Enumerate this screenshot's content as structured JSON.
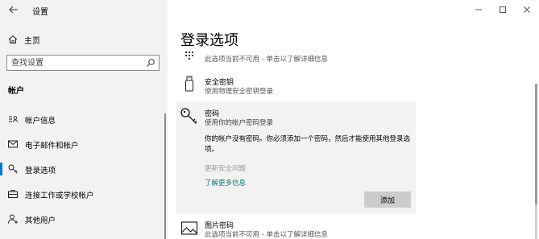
{
  "app": {
    "title": "设置"
  },
  "sidebar": {
    "home_label": "主页",
    "search_placeholder": "查找设置",
    "section_title": "帐户",
    "items": [
      {
        "label": "帐户信息",
        "icon": "person-card-icon"
      },
      {
        "label": "电子邮件和帐户",
        "icon": "mail-icon"
      },
      {
        "label": "登录选项",
        "icon": "key-icon",
        "active": true
      },
      {
        "label": "连接工作或学校帐户",
        "icon": "briefcase-icon"
      },
      {
        "label": "其他用户",
        "icon": "person-add-icon"
      }
    ]
  },
  "main": {
    "title": "登录选项",
    "pin_option": {
      "desc": "此选项当前不可用 - 单击以了解详细信息"
    },
    "security_key": {
      "name": "安全密钥",
      "desc": "使用物理安全密钥登录"
    },
    "password": {
      "name": "密码",
      "desc": "使用你的帐户密码登录",
      "message": "你的帐户没有密码。你必须添加一个密码，然后才能使用其他登录选项。",
      "disabled_link": "更新安全问题",
      "learn_more": "了解更多信息",
      "add_button": "添加"
    },
    "picture_password": {
      "name": "图片密码",
      "desc": "此选项当前不可用 - 单击以了解详细信息"
    }
  },
  "colors": {
    "accent": "#0078d7",
    "link": "#0a7d6a",
    "sidebar_bg": "#f2f2f2",
    "expanded_bg": "#f2f2f2"
  }
}
